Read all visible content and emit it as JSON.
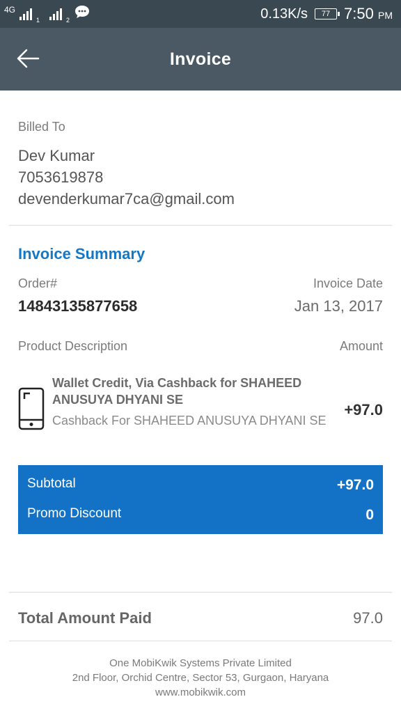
{
  "status_bar": {
    "network_label": "4G",
    "sim2_sub": "2",
    "sim1_sub": "1",
    "speed": "0.13K/s",
    "battery": "77",
    "time": "7:50",
    "ampm": "PM"
  },
  "app_bar": {
    "title": "Invoice",
    "back_icon": "arrow-left-icon"
  },
  "billed": {
    "label": "Billed To",
    "name": "Dev Kumar",
    "phone": "7053619878",
    "email": "devenderkumar7ca@gmail.com"
  },
  "summary": {
    "title": "Invoice Summary",
    "order_label": "Order#",
    "order_no": "14843135877658",
    "date_label": "Invoice Date",
    "date": "Jan 13, 2017",
    "product_header": "Product Description",
    "amount_header": "Amount",
    "item": {
      "icon": "mobile-phone-icon",
      "title": "Wallet Credit, Via Cashback for SHAHEED ANUSUYA DHYANI SE",
      "subtitle": "Cashback For SHAHEED ANUSUYA DHYANI SE",
      "amount": "+97.0"
    }
  },
  "totals": {
    "subtotal_label": "Subtotal",
    "subtotal_value": "+97.0",
    "promo_label": "Promo Discount",
    "promo_value": "0"
  },
  "paid": {
    "label": "Total Amount Paid",
    "value": "97.0"
  },
  "footer": {
    "company": "One MobiKwik Systems Private Limited",
    "address": "2nd Floor, Orchid Centre, Sector 53, Gurgaon, Haryana",
    "website": "www.mobikwik.com"
  },
  "colors": {
    "status_bar": "#3a4852",
    "app_bar": "#4a5963",
    "accent": "#1372c6"
  }
}
